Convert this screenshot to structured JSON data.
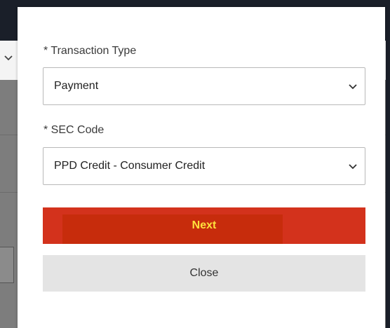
{
  "modal": {
    "transaction_type": {
      "label": "* Transaction Type",
      "value": "Payment"
    },
    "sec_code": {
      "label": "* SEC Code",
      "value": "PPD Credit - Consumer Credit"
    },
    "next_label": "Next",
    "close_label": "Close"
  },
  "colors": {
    "next_button": "#d3321c",
    "next_text": "#ffe13d",
    "close_button": "#e4e4e4",
    "overlay": "#7d7d7d",
    "topbar": "#1a1f29"
  },
  "icons": {
    "select_chevron": "chevron-down-icon",
    "background_chevron": "chevron-down-icon"
  }
}
